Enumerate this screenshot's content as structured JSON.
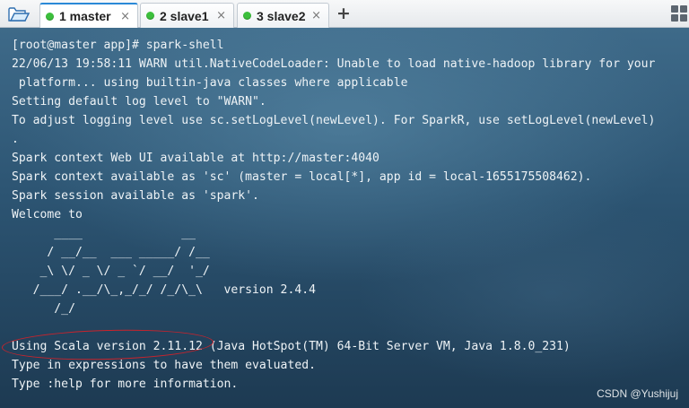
{
  "tabs": [
    {
      "label": "1 master",
      "close": "×",
      "active": true
    },
    {
      "label": "2 slave1",
      "close": "×",
      "active": false
    },
    {
      "label": "3 slave2",
      "close": "×",
      "active": false
    }
  ],
  "add_tab_label": "+",
  "status_dot_color": "#3cbf3c",
  "icons": {
    "open_folder": "open-folder-icon",
    "layout": "grid-layout-icon"
  },
  "terminal": {
    "lines": [
      "[root@master app]# spark-shell",
      "22/06/13 19:58:11 WARN util.NativeCodeLoader: Unable to load native-hadoop library for your",
      " platform... using builtin-java classes where applicable",
      "Setting default log level to \"WARN\".",
      "To adjust logging level use sc.setLogLevel(newLevel). For SparkR, use setLogLevel(newLevel)",
      ".",
      "Spark context Web UI available at http://master:4040",
      "Spark context available as 'sc' (master = local[*], app id = local-1655175508462).",
      "Spark session available as 'spark'.",
      "Welcome to",
      "      ____              __",
      "     / __/__  ___ _____/ /__",
      "    _\\ \\/ _ \\/ _ `/ __/  '_/",
      "   /___/ .__/\\_,_/_/ /_/\\_\\   version 2.4.4",
      "      /_/",
      "",
      "Using Scala version 2.11.12 (Java HotSpot(TM) 64-Bit Server VM, Java 1.8.0_231)",
      "Type in expressions to have them evaluated.",
      "Type :help for more information."
    ]
  },
  "watermark": "CSDN @Yushijuj"
}
